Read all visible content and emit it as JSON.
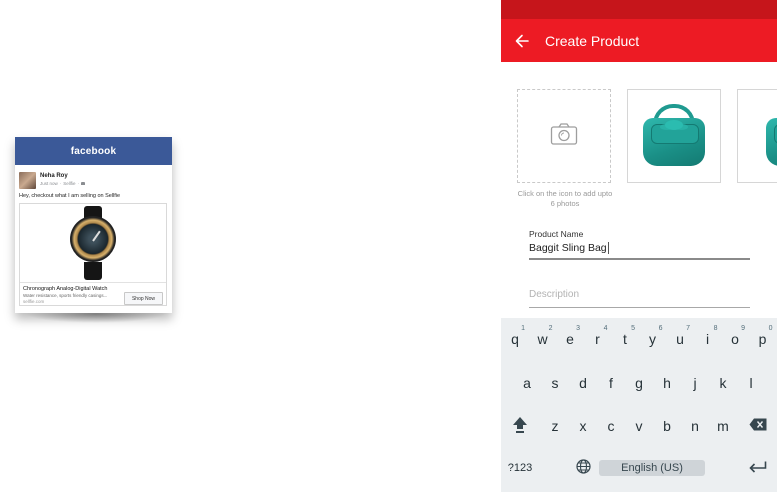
{
  "facebook_card": {
    "brand": "facebook",
    "user_name": "Neha Roy",
    "meta_time": "Just now",
    "meta_app": "Sellfie",
    "post_text": "Hey, checkout what I am selling on Sellfie",
    "product_title": "Chronograph Analog-Digital Watch",
    "product_desc": "Water resistance, sports friendly casings...",
    "product_domain": "sellfie.com",
    "cta_label": "Shop Now"
  },
  "app": {
    "title": "Create Product",
    "colors": {
      "primary": "#ed1b24",
      "status_bar": "#c6151b"
    },
    "photo_hint": "Click on the icon to add upto 6 photos",
    "product_name_label": "Product Name",
    "product_name_value": "Baggit Sling Bag",
    "description_placeholder": "Description"
  },
  "keyboard": {
    "row1": [
      {
        "k": "q",
        "h": "1"
      },
      {
        "k": "w",
        "h": "2"
      },
      {
        "k": "e",
        "h": "3"
      },
      {
        "k": "r",
        "h": "4"
      },
      {
        "k": "t",
        "h": "5"
      },
      {
        "k": "y",
        "h": "6"
      },
      {
        "k": "u",
        "h": "7"
      },
      {
        "k": "i",
        "h": "8"
      },
      {
        "k": "o",
        "h": "9"
      },
      {
        "k": "p",
        "h": "0"
      }
    ],
    "row2": [
      "a",
      "s",
      "d",
      "f",
      "g",
      "h",
      "j",
      "k",
      "l"
    ],
    "row3": [
      "z",
      "x",
      "c",
      "v",
      "b",
      "n",
      "m"
    ],
    "symbols_label": "?123",
    "space_label": "English (US)"
  }
}
